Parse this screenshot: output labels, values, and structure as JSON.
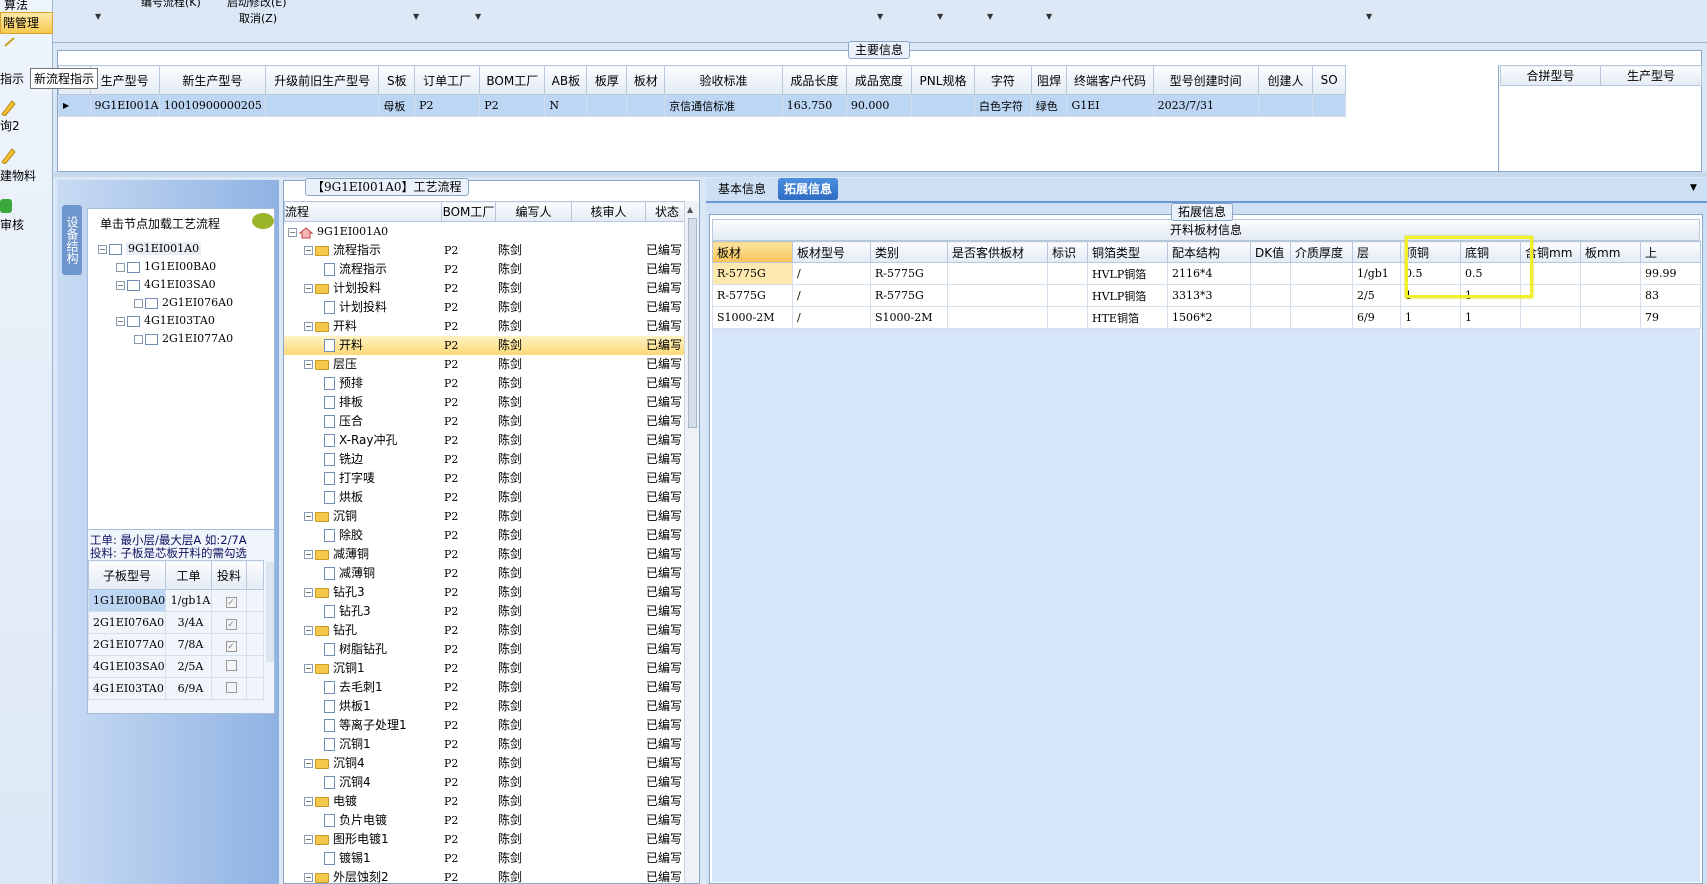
{
  "left_strip": {
    "items": [
      "算法",
      "階管理",
      "指示",
      "询2",
      "建物料",
      "审核"
    ],
    "tooltip": "新流程指示"
  },
  "toolbar": {
    "row1_a": "编号流程(K)",
    "row1_b": "启动修改(E)",
    "row2": "取消(Z)"
  },
  "main_info": {
    "title": "主要信息",
    "columns": [
      "生产型号",
      "新生产型号",
      "升级前旧生产型号",
      "S板",
      "订单工厂",
      "BOM工厂",
      "AB板",
      "板厚",
      "板材",
      "验收标准",
      "成品长度",
      "成品宽度",
      "PNL规格",
      "字符",
      "阻焊",
      "终端客户代码",
      "型号创建时间",
      "创建人",
      "SO"
    ],
    "row": [
      "9G1EI001A0",
      "10010900000205",
      "",
      "母板",
      "P2",
      "P2",
      "N",
      "",
      "",
      "京信通信标准",
      "163.750",
      "90.000",
      "",
      "白色字符",
      "绿色",
      "G1EI",
      "2023/7/31",
      "",
      ""
    ],
    "right_columns": [
      "合拼型号",
      "生产型号"
    ]
  },
  "structure": {
    "tab_label": "设备结构",
    "hint": "单击节点加载工艺流程",
    "nodes": [
      {
        "label": "9G1EI001A0",
        "level": 0
      },
      {
        "label": "1G1EI00BA0",
        "level": 1
      },
      {
        "label": "4G1EI03SA0",
        "level": 1
      },
      {
        "label": "2G1EI076A0",
        "level": 2
      },
      {
        "label": "4G1EI03TA0",
        "level": 1
      },
      {
        "label": "2G1EI077A0",
        "level": 2
      }
    ],
    "note1": "工单: 最小层/最大层A 如:2/7A",
    "note2": "投料: 子板是芯板开料的需勾选",
    "sub_cols": [
      "子板型号",
      "工单",
      "投料"
    ],
    "sub_rows": [
      {
        "model": "1G1EI00BA0",
        "order": "1/gb1A",
        "checked": true
      },
      {
        "model": "2G1EI076A0",
        "order": "3/4A",
        "checked": true
      },
      {
        "model": "2G1EI077A0",
        "order": "7/8A",
        "checked": true
      },
      {
        "model": "4G1EI03SA0",
        "order": "2/5A",
        "checked": false
      },
      {
        "model": "4G1EI03TA0",
        "order": "6/9A",
        "checked": false
      }
    ]
  },
  "process": {
    "title": "【9G1EI001A0】工艺流程",
    "cols": [
      "流程",
      "BOM工厂",
      "编写人",
      "核审人",
      "状态"
    ],
    "root": "9G1EI001A0",
    "rows": [
      {
        "name": "流程指示",
        "type": "folder",
        "bom": "P2",
        "writer": "陈剑",
        "status": "已编写"
      },
      {
        "name": "流程指示",
        "type": "doc",
        "bom": "P2",
        "writer": "陈剑",
        "status": "已编写"
      },
      {
        "name": "计划投料",
        "type": "folder",
        "bom": "P2",
        "writer": "陈剑",
        "status": "已编写"
      },
      {
        "name": "计划投料",
        "type": "doc",
        "bom": "P2",
        "writer": "陈剑",
        "status": "已编写"
      },
      {
        "name": "开料",
        "type": "folder",
        "bom": "P2",
        "writer": "陈剑",
        "status": "已编写"
      },
      {
        "name": "开料",
        "type": "doc",
        "bom": "P2",
        "writer": "陈剑",
        "status": "已编写",
        "selected": true
      },
      {
        "name": "层压",
        "type": "folder",
        "bom": "P2",
        "writer": "陈剑",
        "status": "已编写"
      },
      {
        "name": "预排",
        "type": "doc",
        "bom": "P2",
        "writer": "陈剑",
        "status": "已编写"
      },
      {
        "name": "排板",
        "type": "doc",
        "bom": "P2",
        "writer": "陈剑",
        "status": "已编写"
      },
      {
        "name": "压合",
        "type": "doc",
        "bom": "P2",
        "writer": "陈剑",
        "status": "已编写"
      },
      {
        "name": "X-Ray冲孔",
        "type": "doc",
        "bom": "P2",
        "writer": "陈剑",
        "status": "已编写"
      },
      {
        "name": "铣边",
        "type": "doc",
        "bom": "P2",
        "writer": "陈剑",
        "status": "已编写"
      },
      {
        "name": "打字唛",
        "type": "doc",
        "bom": "P2",
        "writer": "陈剑",
        "status": "已编写"
      },
      {
        "name": "烘板",
        "type": "doc",
        "bom": "P2",
        "writer": "陈剑",
        "status": "已编写"
      },
      {
        "name": "沉铜",
        "type": "folder",
        "bom": "P2",
        "writer": "陈剑",
        "status": "已编写"
      },
      {
        "name": "除胶",
        "type": "doc",
        "bom": "P2",
        "writer": "陈剑",
        "status": "已编写"
      },
      {
        "name": "减薄铜",
        "type": "folder",
        "bom": "P2",
        "writer": "陈剑",
        "status": "已编写"
      },
      {
        "name": "减薄铜",
        "type": "doc",
        "bom": "P2",
        "writer": "陈剑",
        "status": "已编写"
      },
      {
        "name": "钻孔3",
        "type": "folder",
        "bom": "P2",
        "writer": "陈剑",
        "status": "已编写"
      },
      {
        "name": "钻孔3",
        "type": "doc",
        "bom": "P2",
        "writer": "陈剑",
        "status": "已编写"
      },
      {
        "name": "钻孔",
        "type": "folder",
        "bom": "P2",
        "writer": "陈剑",
        "status": "已编写"
      },
      {
        "name": "树脂钻孔",
        "type": "doc",
        "bom": "P2",
        "writer": "陈剑",
        "status": "已编写"
      },
      {
        "name": "沉铜1",
        "type": "folder",
        "bom": "P2",
        "writer": "陈剑",
        "status": "已编写"
      },
      {
        "name": "去毛刺1",
        "type": "doc",
        "bom": "P2",
        "writer": "陈剑",
        "status": "已编写"
      },
      {
        "name": "烘板1",
        "type": "doc",
        "bom": "P2",
        "writer": "陈剑",
        "status": "已编写"
      },
      {
        "name": "等离子处理1",
        "type": "doc",
        "bom": "P2",
        "writer": "陈剑",
        "status": "已编写"
      },
      {
        "name": "沉铜1",
        "type": "doc",
        "bom": "P2",
        "writer": "陈剑",
        "status": "已编写"
      },
      {
        "name": "沉铜4",
        "type": "folder",
        "bom": "P2",
        "writer": "陈剑",
        "status": "已编写"
      },
      {
        "name": "沉铜4",
        "type": "doc",
        "bom": "P2",
        "writer": "陈剑",
        "status": "已编写"
      },
      {
        "name": "电镀",
        "type": "folder",
        "bom": "P2",
        "writer": "陈剑",
        "status": "已编写"
      },
      {
        "name": "负片电镀",
        "type": "doc",
        "bom": "P2",
        "writer": "陈剑",
        "status": "已编写"
      },
      {
        "name": "图形电镀1",
        "type": "folder",
        "bom": "P2",
        "writer": "陈剑",
        "status": "已编写"
      },
      {
        "name": "镀锡1",
        "type": "doc",
        "bom": "P2",
        "writer": "陈剑",
        "status": "已编写"
      },
      {
        "name": "外层蚀刻2",
        "type": "folder",
        "bom": "P2",
        "writer": "陈剑",
        "status": "已编写"
      }
    ]
  },
  "ext": {
    "tabs": [
      "基本信息",
      "拓展信息"
    ],
    "group_title": "拓展信息",
    "table_title": "开料板材信息",
    "cols": [
      "板材",
      "板材型号",
      "类别",
      "是否客供板材",
      "标识",
      "铜箔类型",
      "配本结构",
      "DK值",
      "介质厚度",
      "层",
      "顶铜",
      "底铜",
      "含铜mm",
      "板mm",
      "上"
    ],
    "rows": [
      [
        "R-5775G",
        "/",
        "R-5775G",
        "",
        "",
        "HVLP铜箔",
        "2116*4",
        "",
        "",
        "1/gb1",
        "0.5",
        "0.5",
        "",
        "",
        "99.99"
      ],
      [
        "R-5775G",
        "/",
        "R-5775G",
        "",
        "",
        "HVLP铜箔",
        "3313*3",
        "",
        "",
        "2/5",
        "1",
        "1",
        "",
        "",
        "83"
      ],
      [
        "S1000-2M",
        "/",
        "S1000-2M",
        "",
        "",
        "HTE铜箔",
        "1506*2",
        "",
        "",
        "6/9",
        "1",
        "1",
        "",
        "",
        "79"
      ]
    ]
  },
  "colors": {
    "selected_row": "#bcd6f4",
    "highlight_box": "#f0ef2a",
    "selected_tree": "#fde68a"
  }
}
